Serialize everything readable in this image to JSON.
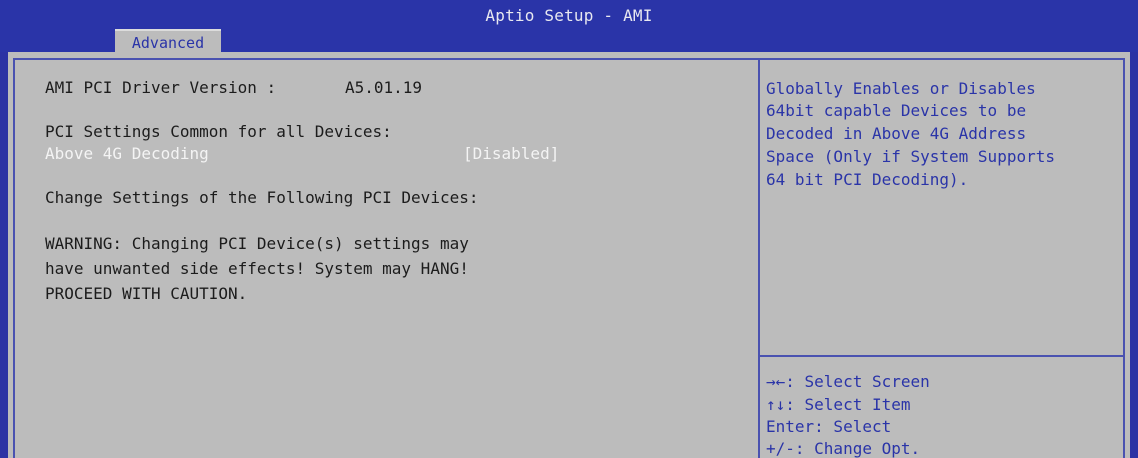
{
  "header": {
    "title": "Aptio Setup - AMI",
    "tabs": [
      {
        "label": "Advanced"
      }
    ]
  },
  "main": {
    "driver_version_label": "AMI PCI Driver Version :",
    "driver_version_value": "A5.01.19",
    "pci_common_heading": "PCI Settings Common for all Devices:",
    "above4g": {
      "label": "Above 4G Decoding",
      "value": "[Disabled]"
    },
    "change_settings_heading": "Change Settings of the Following PCI Devices:",
    "warning_lines": [
      "WARNING: Changing PCI Device(s) settings may",
      "have unwanted side effects! System may HANG!",
      "PROCEED WITH CAUTION."
    ]
  },
  "help": {
    "description_lines": [
      "Globally Enables or Disables",
      "64bit capable Devices to be",
      "Decoded in Above 4G Address",
      "Space (Only if System Supports",
      "64 bit PCI Decoding)."
    ],
    "key_hints": [
      "→←: Select Screen",
      "↑↓: Select Item",
      "Enter: Select",
      "+/-: Change Opt."
    ]
  },
  "colors": {
    "background_blue": "#2b32a4",
    "panel_gray": "#bcbcbc",
    "help_text_blue": "#2a34a8",
    "highlight_white": "#f4f4f4"
  }
}
